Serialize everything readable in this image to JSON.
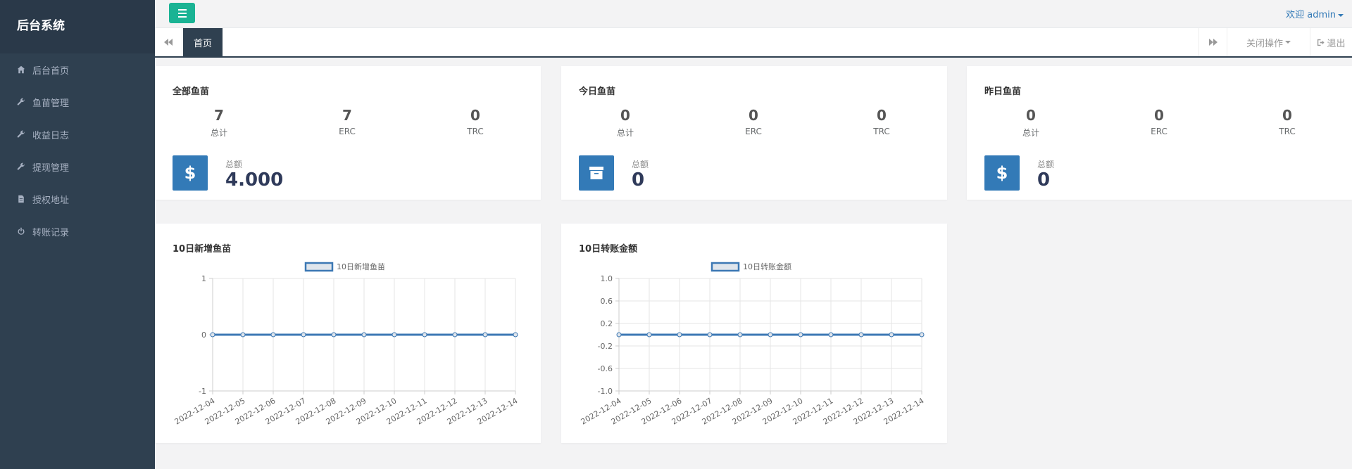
{
  "app": {
    "title": "后台系统"
  },
  "sidebar": {
    "items": [
      {
        "label": "后台首页",
        "icon": "home-icon"
      },
      {
        "label": "鱼苗管理",
        "icon": "wrench-icon"
      },
      {
        "label": "收益日志",
        "icon": "wrench-icon"
      },
      {
        "label": "提现管理",
        "icon": "wrench-icon"
      },
      {
        "label": "授权地址",
        "icon": "file-icon"
      },
      {
        "label": "转账记录",
        "icon": "power-icon"
      }
    ]
  },
  "header": {
    "welcome": "欢迎 admin"
  },
  "tabs": {
    "active": "首页",
    "close_ops": "关闭操作",
    "logout": "退出"
  },
  "cards": [
    {
      "title": "全部鱼苗",
      "stats": [
        {
          "value": "7",
          "label": "总计"
        },
        {
          "value": "7",
          "label": "ERC"
        },
        {
          "value": "0",
          "label": "TRC"
        }
      ],
      "amount_label": "总额",
      "amount": "4.000",
      "icon": "dollar-icon",
      "icon_glyph": "$"
    },
    {
      "title": "今日鱼苗",
      "stats": [
        {
          "value": "0",
          "label": "总计"
        },
        {
          "value": "0",
          "label": "ERC"
        },
        {
          "value": "0",
          "label": "TRC"
        }
      ],
      "amount_label": "总额",
      "amount": "0",
      "icon": "archive-icon",
      "icon_glyph": ""
    },
    {
      "title": "昨日鱼苗",
      "stats": [
        {
          "value": "0",
          "label": "总计"
        },
        {
          "value": "0",
          "label": "ERC"
        },
        {
          "value": "0",
          "label": "TRC"
        }
      ],
      "amount_label": "总额",
      "amount": "0",
      "icon": "dollar-icon",
      "icon_glyph": "$"
    }
  ],
  "colors": {
    "sidebar": "#2f4050",
    "accent": "#1ab394",
    "primary": "#337ab7",
    "line": "#3c78b4"
  },
  "chart_data": [
    {
      "panel_title": "10日新增鱼苗",
      "type": "line",
      "x": [
        "2022-12-04",
        "2022-12-05",
        "2022-12-06",
        "2022-12-07",
        "2022-12-08",
        "2022-12-09",
        "2022-12-10",
        "2022-12-11",
        "2022-12-12",
        "2022-12-13",
        "2022-12-14"
      ],
      "series": [
        {
          "name": "10日新增鱼苗",
          "values": [
            0,
            0,
            0,
            0,
            0,
            0,
            0,
            0,
            0,
            0,
            0
          ]
        }
      ],
      "yticks": [
        "1",
        "0",
        "-1"
      ],
      "ytick_values": [
        1,
        0,
        -1
      ],
      "ylim": [
        -1,
        1
      ],
      "grid": true,
      "legend": "top-center"
    },
    {
      "panel_title": "10日转账金额",
      "type": "line",
      "x": [
        "2022-12-04",
        "2022-12-05",
        "2022-12-06",
        "2022-12-07",
        "2022-12-08",
        "2022-12-09",
        "2022-12-10",
        "2022-12-11",
        "2022-12-12",
        "2022-12-13",
        "2022-12-14"
      ],
      "series": [
        {
          "name": "10日转账金额",
          "values": [
            0,
            0,
            0,
            0,
            0,
            0,
            0,
            0,
            0,
            0,
            0
          ]
        }
      ],
      "yticks": [
        "1.0",
        "0.6",
        "0.2",
        "-0.2",
        "-0.6",
        "-1.0"
      ],
      "ytick_values": [
        1.0,
        0.6,
        0.2,
        -0.2,
        -0.6,
        -1.0
      ],
      "ylim": [
        -1,
        1
      ],
      "grid": true,
      "legend": "top-center"
    }
  ]
}
